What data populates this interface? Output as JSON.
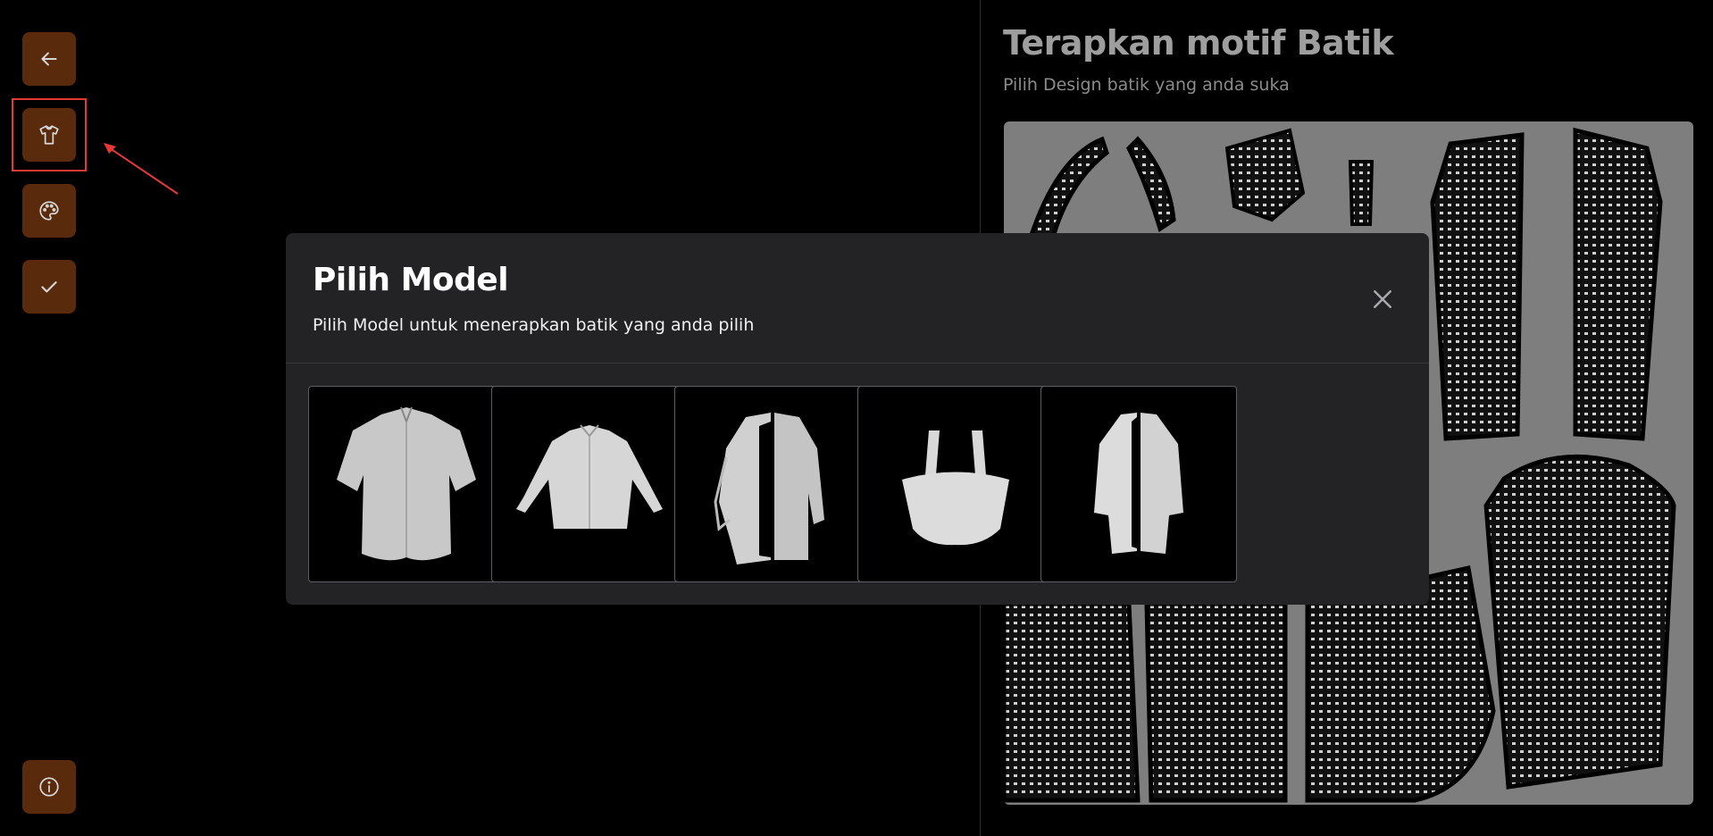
{
  "sidebar": {
    "items": [
      {
        "icon": "arrow-left-icon",
        "label": "Back"
      },
      {
        "icon": "shirt-icon",
        "label": "Model"
      },
      {
        "icon": "palette-icon",
        "label": "Motif"
      },
      {
        "icon": "check-icon",
        "label": "Done"
      }
    ],
    "bottom_icon": "info-icon"
  },
  "panel": {
    "title": "Terapkan motif Batik",
    "subtitle": "Pilih Design batik yang anda suka"
  },
  "modal": {
    "title": "Pilih Model",
    "subtitle": "Pilih Model untuk menerapkan batik yang anda pilih",
    "close_icon": "close-icon",
    "models": [
      {
        "name": "short-sleeve-shirt"
      },
      {
        "name": "long-sleeve-shirt"
      },
      {
        "name": "long-outer-coat"
      },
      {
        "name": "bag"
      },
      {
        "name": "long-cardigan"
      }
    ]
  },
  "colors": {
    "background": "#000000",
    "sidebar_button": "#5a2a0c",
    "sidebar_icon": "#d6d6d6",
    "highlight": "#e53935",
    "modal_bg": "#232326",
    "pattern_bg": "#7e7e7e"
  }
}
